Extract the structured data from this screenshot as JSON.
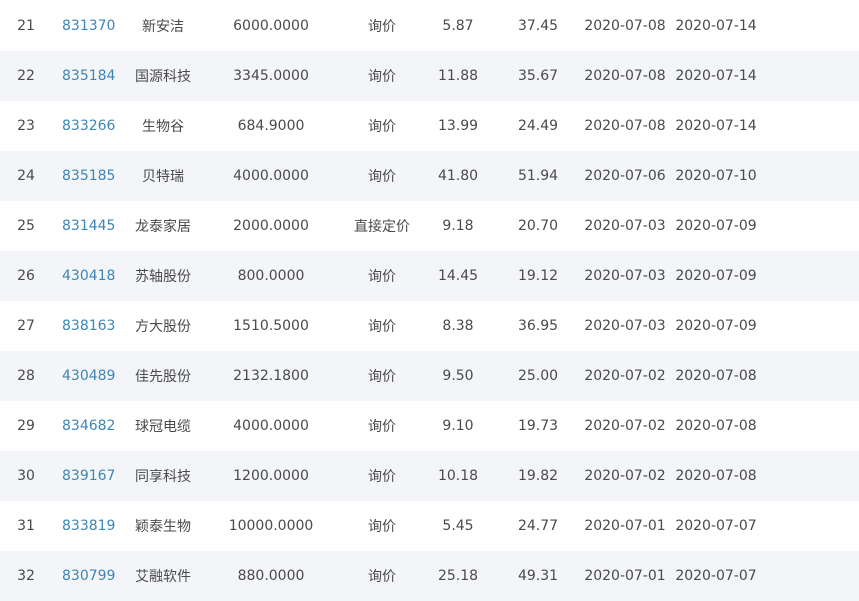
{
  "rows": [
    {
      "idx": "21",
      "code": "831370",
      "name": "新安洁",
      "amount": "6000.0000",
      "method": "询价",
      "price": "5.87",
      "pe": "37.45",
      "date1": "2020-07-08",
      "date2": "2020-07-14"
    },
    {
      "idx": "22",
      "code": "835184",
      "name": "国源科技",
      "amount": "3345.0000",
      "method": "询价",
      "price": "11.88",
      "pe": "35.67",
      "date1": "2020-07-08",
      "date2": "2020-07-14"
    },
    {
      "idx": "23",
      "code": "833266",
      "name": "生物谷",
      "amount": "684.9000",
      "method": "询价",
      "price": "13.99",
      "pe": "24.49",
      "date1": "2020-07-08",
      "date2": "2020-07-14"
    },
    {
      "idx": "24",
      "code": "835185",
      "name": "贝特瑞",
      "amount": "4000.0000",
      "method": "询价",
      "price": "41.80",
      "pe": "51.94",
      "date1": "2020-07-06",
      "date2": "2020-07-10"
    },
    {
      "idx": "25",
      "code": "831445",
      "name": "龙泰家居",
      "amount": "2000.0000",
      "method": "直接定价",
      "price": "9.18",
      "pe": "20.70",
      "date1": "2020-07-03",
      "date2": "2020-07-09"
    },
    {
      "idx": "26",
      "code": "430418",
      "name": "苏轴股份",
      "amount": "800.0000",
      "method": "询价",
      "price": "14.45",
      "pe": "19.12",
      "date1": "2020-07-03",
      "date2": "2020-07-09"
    },
    {
      "idx": "27",
      "code": "838163",
      "name": "方大股份",
      "amount": "1510.5000",
      "method": "询价",
      "price": "8.38",
      "pe": "36.95",
      "date1": "2020-07-03",
      "date2": "2020-07-09"
    },
    {
      "idx": "28",
      "code": "430489",
      "name": "佳先股份",
      "amount": "2132.1800",
      "method": "询价",
      "price": "9.50",
      "pe": "25.00",
      "date1": "2020-07-02",
      "date2": "2020-07-08"
    },
    {
      "idx": "29",
      "code": "834682",
      "name": "球冠电缆",
      "amount": "4000.0000",
      "method": "询价",
      "price": "9.10",
      "pe": "19.73",
      "date1": "2020-07-02",
      "date2": "2020-07-08"
    },
    {
      "idx": "30",
      "code": "839167",
      "name": "同享科技",
      "amount": "1200.0000",
      "method": "询价",
      "price": "10.18",
      "pe": "19.82",
      "date1": "2020-07-02",
      "date2": "2020-07-08"
    },
    {
      "idx": "31",
      "code": "833819",
      "name": "颖泰生物",
      "amount": "10000.0000",
      "method": "询价",
      "price": "5.45",
      "pe": "24.77",
      "date1": "2020-07-01",
      "date2": "2020-07-07"
    },
    {
      "idx": "32",
      "code": "830799",
      "name": "艾融软件",
      "amount": "880.0000",
      "method": "询价",
      "price": "25.18",
      "pe": "49.31",
      "date1": "2020-07-01",
      "date2": "2020-07-07"
    }
  ],
  "colors": {
    "link": "#3c86b5",
    "text": "#4a4a4a",
    "stripe": "#f3f5f8"
  }
}
